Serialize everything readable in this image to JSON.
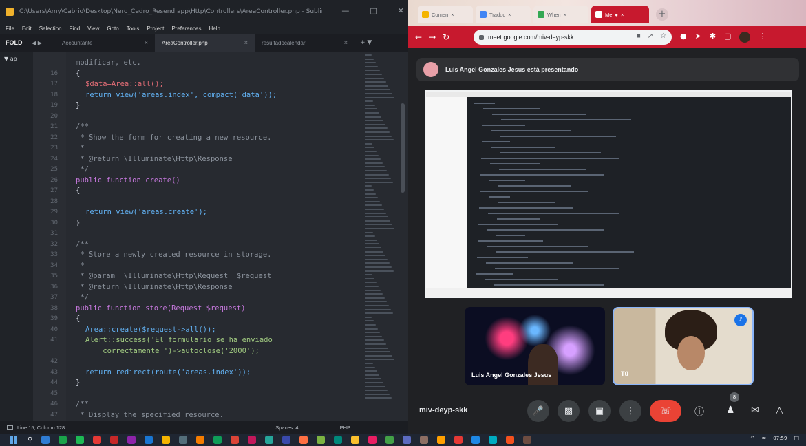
{
  "editor": {
    "title_path": "C:\\Users\\Amy\\Cabrio\\Desktop\\Nero_Cedro_Resend app\\Http\\Controllers\\AreaController.php - Sublime Text",
    "menu": [
      "File",
      "Edit",
      "Selection",
      "Find",
      "View",
      "Goto",
      "Tools",
      "Project",
      "Preferences",
      "Help"
    ],
    "folders_label": "FOLD",
    "sidebar_folder": "▼ ap",
    "tabs": [
      {
        "label": "Accountante",
        "active": false
      },
      {
        "label": "AreaController.php",
        "active": true
      },
      {
        "label": "resultadocalendar",
        "active": false
      }
    ],
    "lines": [
      {
        "n": "",
        "text": "modificar, etc.",
        "cls": "c-comment",
        "indent": 2
      },
      {
        "n": "16",
        "text": "{",
        "cls": "c-plain",
        "indent": 2
      },
      {
        "n": "17",
        "text": "$data=Area::all();",
        "cls": "c-var",
        "indent": 3
      },
      {
        "n": "18",
        "text": "return view('areas.index', compact('data'));",
        "cls": "c-fn",
        "indent": 3
      },
      {
        "n": "19",
        "text": "}",
        "cls": "c-plain",
        "indent": 2
      },
      {
        "n": "20",
        "text": "",
        "cls": "c-plain",
        "indent": 0
      },
      {
        "n": "21",
        "text": "/**",
        "cls": "c-comment",
        "indent": 2
      },
      {
        "n": "22",
        "text": " * Show the form for creating a new resource.",
        "cls": "c-comment",
        "indent": 2
      },
      {
        "n": "23",
        "text": " *",
        "cls": "c-comment",
        "indent": 2
      },
      {
        "n": "24",
        "text": " * @return \\Illuminate\\Http\\Response",
        "cls": "c-comment",
        "indent": 2
      },
      {
        "n": "25",
        "text": " */",
        "cls": "c-comment",
        "indent": 2
      },
      {
        "n": "26",
        "text": "public function create()",
        "cls": "c-kw",
        "indent": 2
      },
      {
        "n": "27",
        "text": "{",
        "cls": "c-plain",
        "indent": 2
      },
      {
        "n": "28",
        "text": "",
        "cls": "c-plain",
        "indent": 0
      },
      {
        "n": "29",
        "text": "return view('areas.create');",
        "cls": "c-fn",
        "indent": 3
      },
      {
        "n": "30",
        "text": "}",
        "cls": "c-plain",
        "indent": 2
      },
      {
        "n": "31",
        "text": "",
        "cls": "c-plain",
        "indent": 0
      },
      {
        "n": "32",
        "text": "/**",
        "cls": "c-comment",
        "indent": 2
      },
      {
        "n": "33",
        "text": " * Store a newly created resource in storage.",
        "cls": "c-comment",
        "indent": 2
      },
      {
        "n": "34",
        "text": " *",
        "cls": "c-comment",
        "indent": 2
      },
      {
        "n": "35",
        "text": " * @param  \\Illuminate\\Http\\Request  $request",
        "cls": "c-comment",
        "indent": 2
      },
      {
        "n": "36",
        "text": " * @return \\Illuminate\\Http\\Response",
        "cls": "c-comment",
        "indent": 2
      },
      {
        "n": "37",
        "text": " */",
        "cls": "c-comment",
        "indent": 2
      },
      {
        "n": "38",
        "text": "public function store(Request $request)",
        "cls": "c-kw",
        "indent": 2
      },
      {
        "n": "39",
        "text": "{",
        "cls": "c-plain",
        "indent": 2
      },
      {
        "n": "40",
        "text": "Area::create($request->all());",
        "cls": "c-fn",
        "indent": 3
      },
      {
        "n": "41",
        "text": "Alert::success('El formulario se ha enviado",
        "cls": "c-str",
        "indent": 3
      },
      {
        "n": "",
        "text": "    correctamente ')->autoclose('2000');",
        "cls": "c-str",
        "indent": 3
      },
      {
        "n": "42",
        "text": "",
        "cls": "c-plain",
        "indent": 0
      },
      {
        "n": "43",
        "text": "return redirect(route('areas.index'));",
        "cls": "c-fn",
        "indent": 3
      },
      {
        "n": "44",
        "text": "}",
        "cls": "c-plain",
        "indent": 2
      },
      {
        "n": "45",
        "text": "",
        "cls": "c-plain",
        "indent": 0
      },
      {
        "n": "46",
        "text": "/**",
        "cls": "c-comment",
        "indent": 2
      },
      {
        "n": "47",
        "text": " * Display the specified resource.",
        "cls": "c-comment",
        "indent": 2
      }
    ],
    "status": {
      "position": "Line 15, Column 128",
      "spaces": "Spaces: 4",
      "syntax": "PHP"
    }
  },
  "browser": {
    "tabs": [
      "Comen",
      "Traduc",
      "When",
      "Me"
    ],
    "url": "meet.google.com/miv-deyp-skk",
    "accent_color": "#c7192e"
  },
  "meet": {
    "presenting_text": "Luis Angel Gonzales Jesus está presentando",
    "participant_name": "Luis Angel Gonzales Jesus",
    "self_name": "Tú",
    "meeting_code": "miv-deyp-skk",
    "participants_count": "8"
  },
  "taskbar": {
    "time": "07:59"
  }
}
